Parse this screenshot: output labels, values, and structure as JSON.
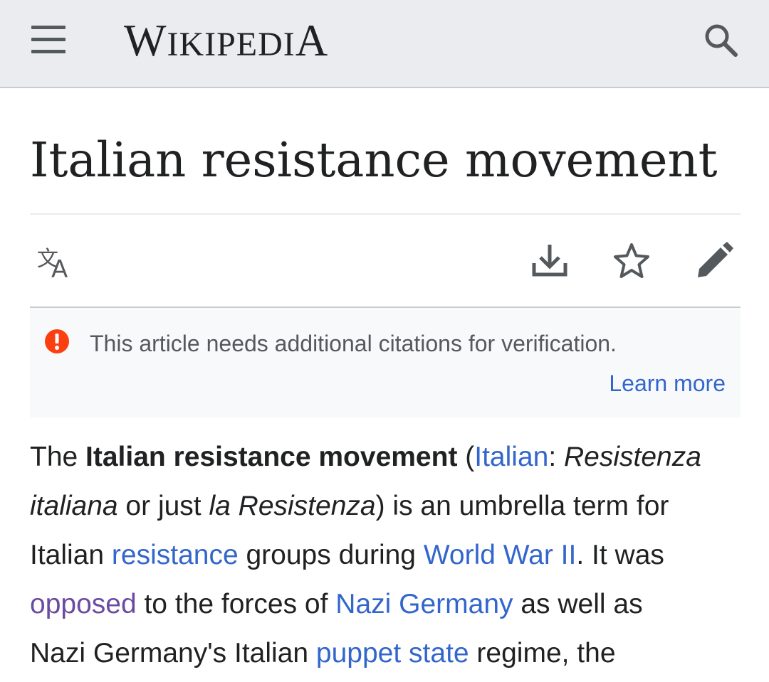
{
  "header": {
    "menu_icon": "hamburger-menu-icon",
    "wordmark": {
      "first_letter": "W",
      "middle": "IKIPEDI",
      "last_letter": "A"
    },
    "search_icon": "search-icon"
  },
  "page": {
    "title": "Italian resistance movement"
  },
  "actions": {
    "language_icon": "language-icon",
    "download_icon": "download-icon",
    "watch_icon": "star-icon",
    "edit_icon": "pencil-icon"
  },
  "notice": {
    "icon": "warning-icon",
    "text": "This article needs additional citations for verification.",
    "link": "Learn more"
  },
  "article": {
    "line1": {
      "t1": "The ",
      "bold": "Italian resistance movement",
      "t2": " (",
      "link_italian": "Italian",
      "t3": ": ",
      "em1": "Resistenza"
    },
    "line2": {
      "em2": "italiana",
      "t4": " or just ",
      "em3": "la Resistenza",
      "t5": ") is an umbrella term for"
    },
    "line3": {
      "t6": "Italian ",
      "link_resistance": "resistance",
      "t7": " groups during ",
      "link_ww2": "World War II",
      "t8": ". It was"
    },
    "line4": {
      "link_opposed": "opposed",
      "t9": " to the forces of ",
      "link_nazi_germany": "Nazi Germany",
      "t10": " as well as"
    },
    "line5": {
      "t11": "Nazi Germany's Italian ",
      "link_puppet_state": "puppet state",
      "t12": " regime, the"
    }
  },
  "colors": {
    "header_bg": "#eaecf0",
    "link": "#3366cc",
    "visited_link": "#6b4ba1",
    "warning": "#fc3f10",
    "notice_bg": "#f8f9fa",
    "text": "#202122"
  }
}
